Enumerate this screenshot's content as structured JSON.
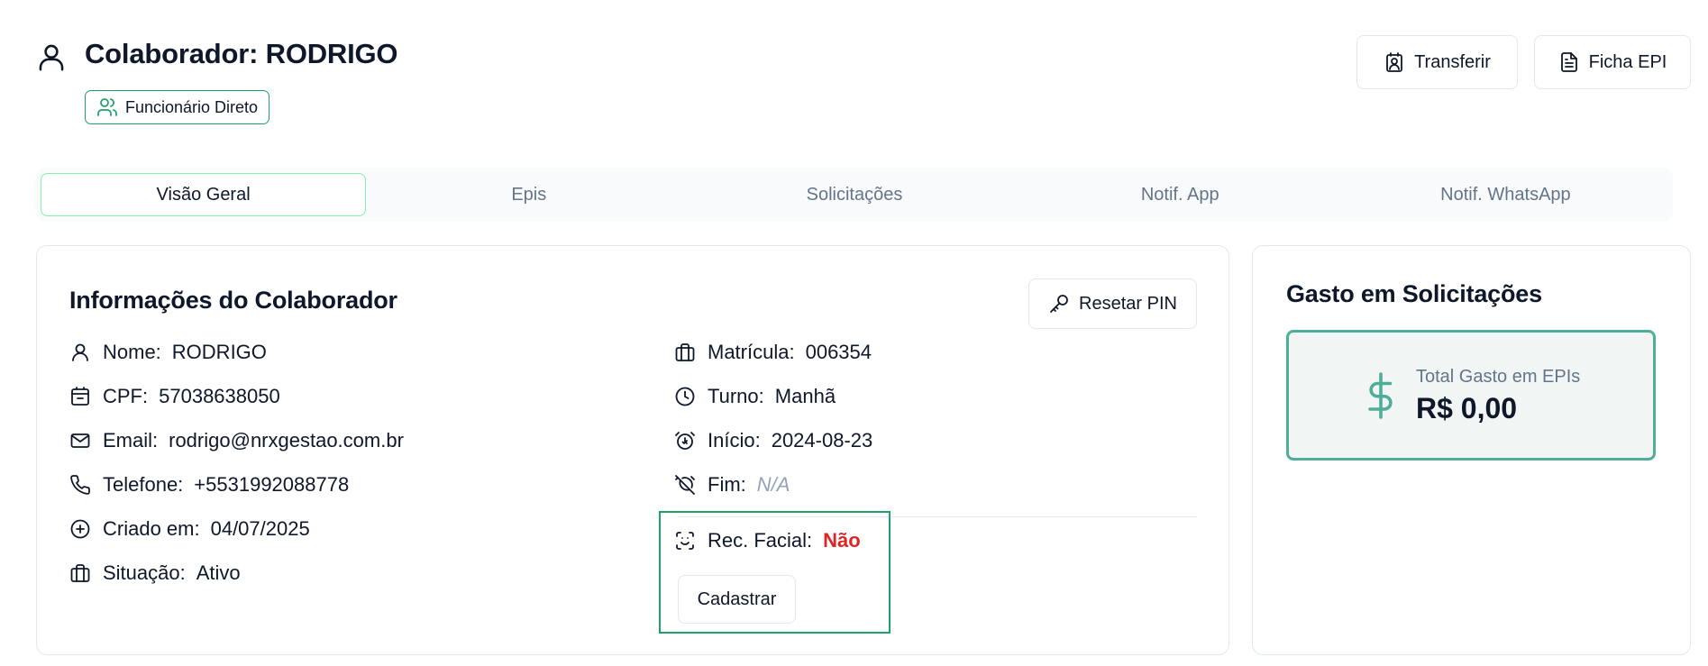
{
  "header": {
    "title": "Colaborador: RODRIGO",
    "badge": "Funcionário Direto"
  },
  "actions": {
    "transfer_label": "Transferir",
    "epi_sheet_label": "Ficha EPI"
  },
  "tabs": [
    {
      "label": "Visão Geral",
      "active": true
    },
    {
      "label": "Epis",
      "active": false
    },
    {
      "label": "Solicitações",
      "active": false
    },
    {
      "label": "Notif. App",
      "active": false
    },
    {
      "label": "Notif. WhatsApp",
      "active": false
    }
  ],
  "info": {
    "title": "Informações do Colaborador",
    "reset_pin_label": "Resetar PIN",
    "nome_label": "Nome:",
    "nome": "RODRIGO",
    "cpf_label": "CPF:",
    "cpf": "57038638050",
    "email_label": "Email:",
    "email": "rodrigo@nrxgestao.com.br",
    "telefone_label": "Telefone:",
    "telefone": "+5531992088778",
    "criado_label": "Criado em:",
    "criado": "04/07/2025",
    "situacao_label": "Situação:",
    "situacao": "Ativo",
    "matricula_label": "Matrícula:",
    "matricula": "006354",
    "turno_label": "Turno:",
    "turno": "Manhã",
    "inicio_label": "Início:",
    "inicio": "2024-08-23",
    "fim_label": "Fim:",
    "fim": "N/A",
    "facial_label": "Rec. Facial:",
    "facial": "Não",
    "cadastrar_label": "Cadastrar"
  },
  "spending": {
    "title": "Gasto em Solicitações",
    "label": "Total Gasto em EPIs",
    "value": "R$ 0,00"
  },
  "colors": {
    "accent_green": "#22a06b",
    "spend_border": "#4fae99",
    "danger": "#dc2626"
  }
}
